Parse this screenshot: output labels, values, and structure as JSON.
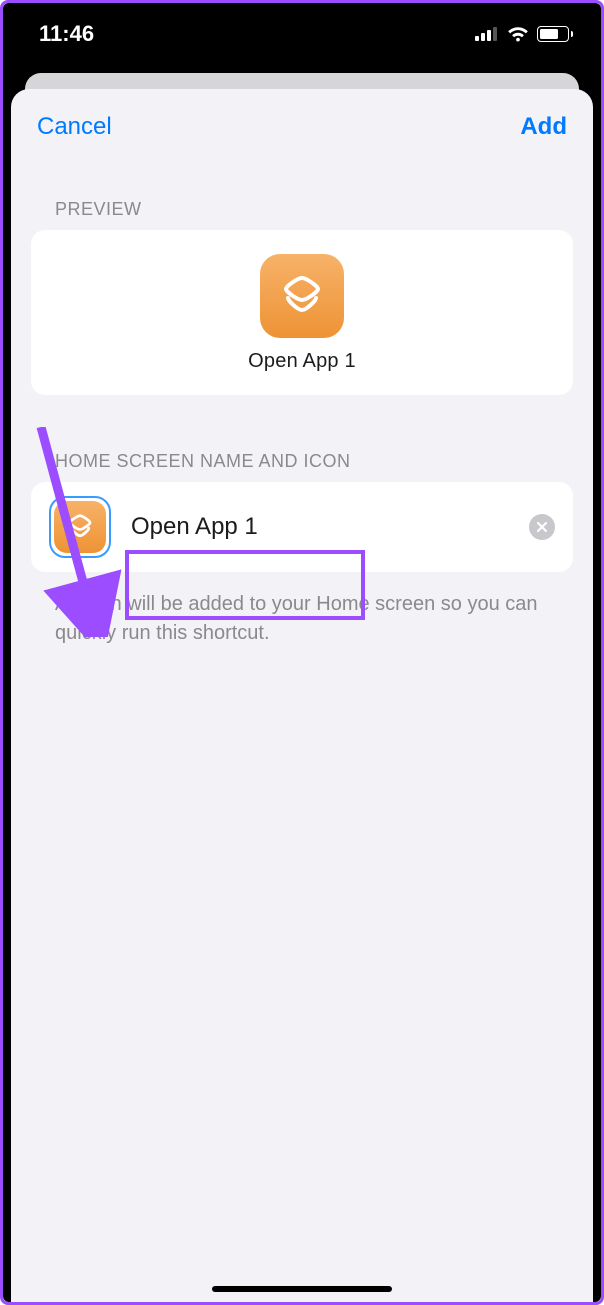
{
  "status": {
    "time": "11:46",
    "battery_pct": "61"
  },
  "header": {
    "cancel": "Cancel",
    "add": "Add"
  },
  "sections": {
    "preview_label": "PREVIEW",
    "name_icon_label": "HOME SCREEN NAME AND ICON"
  },
  "preview": {
    "app_name": "Open App 1"
  },
  "edit": {
    "name_value": "Open App 1"
  },
  "hint": "An icon will be added to your Home screen so you can quickly run this shortcut.",
  "colors": {
    "accent_blue": "#007aff",
    "icon_orange_top": "#f7b269",
    "icon_orange_bottom": "#ee9335",
    "annotation_purple": "#9b4dff"
  }
}
